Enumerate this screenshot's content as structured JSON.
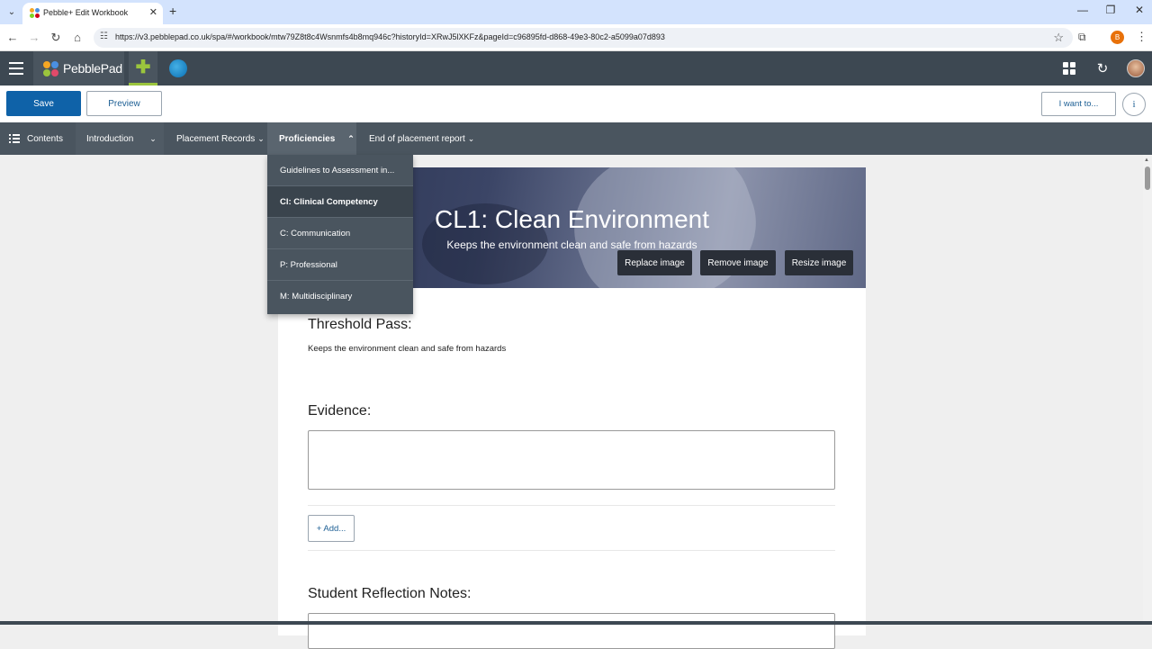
{
  "browser": {
    "tab_title": "Pebble+ Edit Workbook",
    "url": "https://v3.pebblepad.co.uk/spa/#/workbook/mtw79Z8t8c4Wsnmfs4b8mq946c?historyId=XRwJ5lXKFz&pageId=c96895fd-d868-49e3-80c2-a5099a07d893",
    "profile_initial": "B",
    "new_tab_glyph": "+",
    "close_glyph": "✕"
  },
  "app": {
    "logo_text": "PebblePad",
    "colors": {
      "header": "#3d4852",
      "nav": "#4a555f",
      "primary": "#0f62a8",
      "accent_green": "#9bc53d"
    }
  },
  "toolbar": {
    "save_label": "Save",
    "preview_label": "Preview",
    "iwant_label": "I want to...",
    "info_label": "i"
  },
  "nav": {
    "contents_label": "Contents",
    "items": [
      {
        "label": "Introduction"
      },
      {
        "label": "Placement Records"
      },
      {
        "label": "Proficiencies"
      },
      {
        "label": "End of placement report"
      }
    ]
  },
  "dropdown": {
    "items": [
      {
        "label": "Guidelines to Assessment in..."
      },
      {
        "label": "Cl: Clinical Competency"
      },
      {
        "label": "C: Communication"
      },
      {
        "label": "P: Professional"
      },
      {
        "label": "M: Multidisciplinary"
      }
    ],
    "selected_index": 1
  },
  "banner": {
    "title": "CL1: Clean Environment",
    "subtitle": "Keeps the environment clean and safe from hazards",
    "replace_label": "Replace image",
    "remove_label": "Remove image",
    "resize_label": "Resize image"
  },
  "content": {
    "threshold_heading": "Threshold Pass:",
    "threshold_text": "Keeps the environment clean and safe from hazards",
    "evidence_heading": "Evidence:",
    "add_label": "+ Add...",
    "notes_heading": "Student Reflection Notes:"
  }
}
